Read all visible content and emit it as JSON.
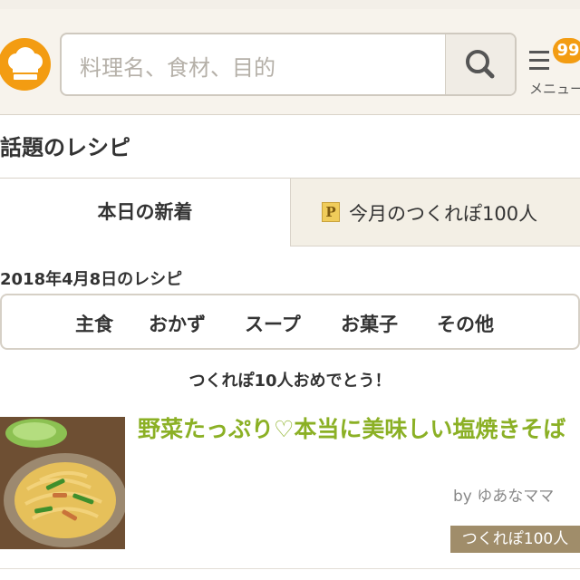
{
  "header": {
    "search_placeholder": "料理名、食材、目的",
    "menu_label": "メニュー",
    "menu_badge": "99"
  },
  "section": {
    "title": "話題のレシピ"
  },
  "tabs": [
    {
      "label": "本日の新着",
      "active": true
    },
    {
      "label": "今月のつくれぽ100人",
      "active": false,
      "icon": "p-icon"
    }
  ],
  "date_label": "2018年4月8日のレシピ",
  "categories": [
    "主食",
    "おかず",
    "スープ",
    "お菓子",
    "その他"
  ],
  "congrats": "つくれぽ10人おめでとう！",
  "recipe": {
    "title": "野菜たっぷり♡本当に美味しい塩焼きそば",
    "author": "by ゆあなママ",
    "badge": "つくれぽ100人"
  },
  "colors": {
    "accent": "#f39c12",
    "title_green": "#8bb025",
    "badge_brown": "#a08d6a"
  }
}
